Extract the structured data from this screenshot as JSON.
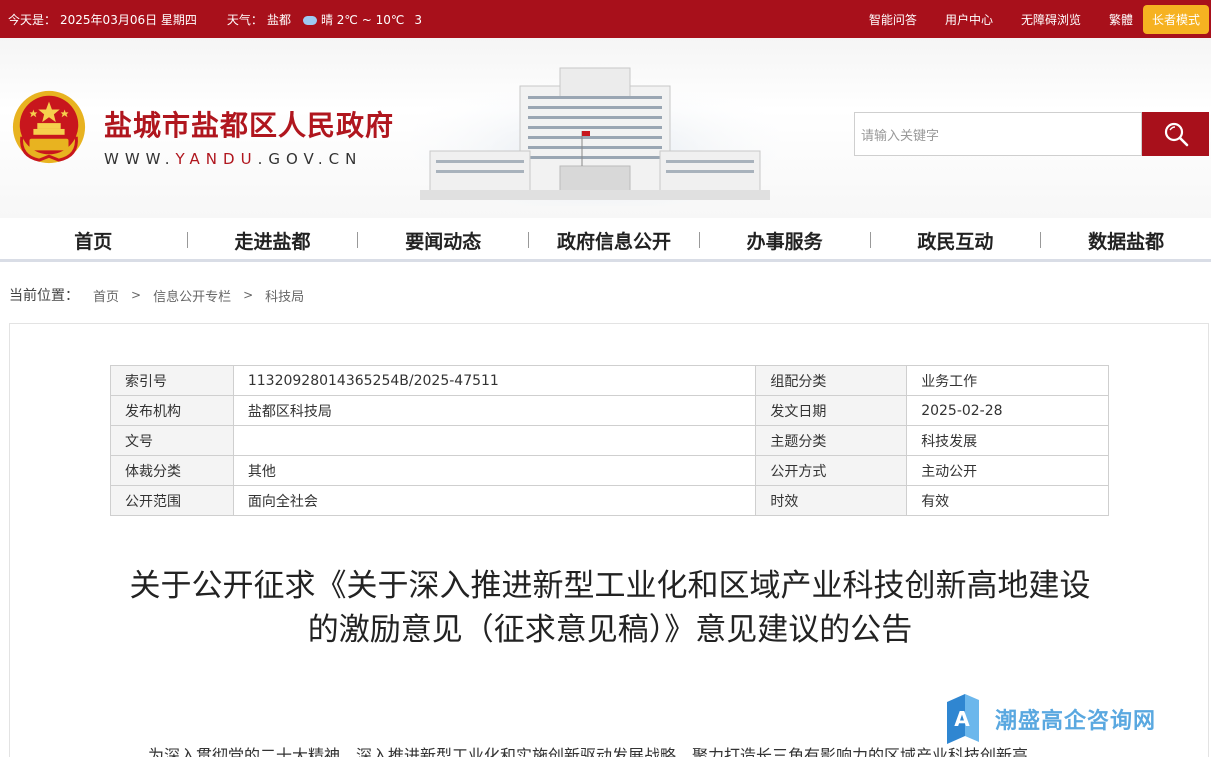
{
  "topbar": {
    "date_label": "今天是：",
    "date": "2025年03月06日 星期四",
    "weather_label": "天气：",
    "city": "盐都",
    "weather": "晴 2℃ ~ 10℃",
    "weather_extra": "3",
    "links": [
      "智能问答",
      "用户中心",
      "无障碍浏览",
      "繁體"
    ],
    "elder_mode": "长者模式"
  },
  "header": {
    "title": "盐城市盐都区人民政府",
    "url_prefix": "WWW.",
    "url_hl": "YANDU",
    "url_suffix": ".GOV.CN",
    "search_placeholder": "请输入关键字"
  },
  "nav": [
    "首页",
    "走进盐都",
    "要闻动态",
    "政府信息公开",
    "办事服务",
    "政民互动",
    "数据盐都"
  ],
  "breadcrumb": {
    "label": "当前位置：",
    "items": [
      "首页",
      "信息公开专栏",
      "科技局"
    ]
  },
  "meta": {
    "rows": [
      [
        "索引号",
        "11320928014365254B/2025-47511",
        "组配分类",
        "业务工作"
      ],
      [
        "发布机构",
        "盐都区科技局",
        "发文日期",
        "2025-02-28"
      ],
      [
        "文号",
        "",
        "主题分类",
        "科技发展"
      ],
      [
        "体裁分类",
        "其他",
        "公开方式",
        "主动公开"
      ],
      [
        "公开范围",
        "面向全社会",
        "时效",
        "有效"
      ]
    ]
  },
  "article": {
    "title_line1": "关于公开征求《关于深入推进新型工业化和区域产业科技创新高地建设",
    "title_line2": "的激励意见（征求意见稿）》意见建议的公告",
    "body_partial": "为深入贯彻党的二十大精神，深入推进新型工业化和实施创新驱动发展战略，聚力打造长三角有影响力的区域产业科技创新高"
  },
  "watermark": {
    "text": "潮盛高企咨询网",
    "logo_letter": "A"
  },
  "colors": {
    "brand_red": "#a8101b",
    "elder_orange": "#f6b221",
    "watermark_blue": "#5aa8e0"
  }
}
